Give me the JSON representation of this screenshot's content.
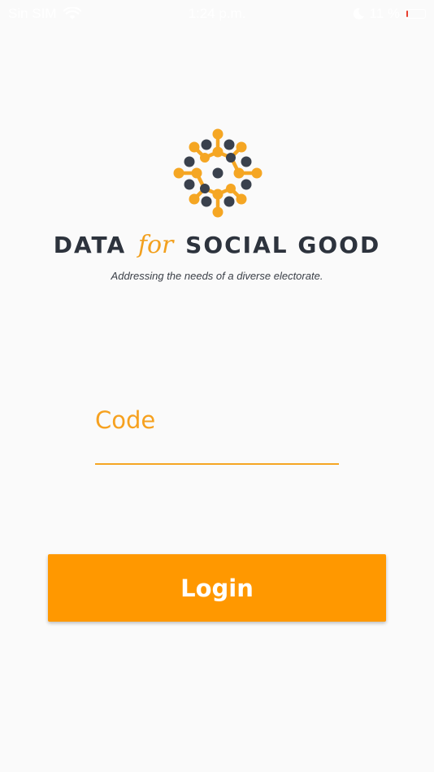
{
  "status_bar": {
    "carrier": "Sin SIM",
    "time": "1:24 p.m.",
    "battery_percent": "11 %",
    "icons": [
      "wifi-icon",
      "moon-icon",
      "battery-icon"
    ]
  },
  "brand": {
    "name_left": "DATA",
    "name_for": "for",
    "name_right": "SOCIAL GOOD",
    "tagline": "Addressing the needs of a diverse electorate."
  },
  "login_form": {
    "code_label": "Code",
    "code_value": "",
    "login_label": "Login"
  },
  "colors": {
    "accent": "#ff9800",
    "accent_text": "#f6a11f",
    "logo_orange": "#f5a623",
    "logo_dark": "#3a414d",
    "brand_text": "#2d333d",
    "background": "#fafafa"
  }
}
